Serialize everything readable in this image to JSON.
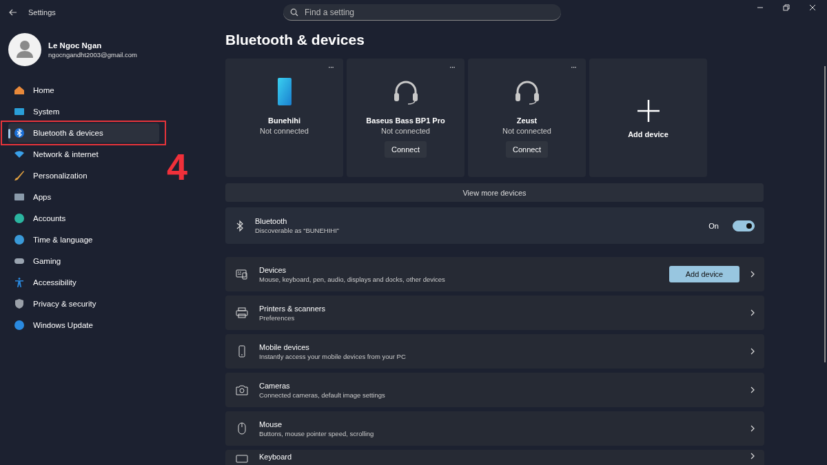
{
  "window": {
    "title": "Settings"
  },
  "search": {
    "placeholder": "Find a setting"
  },
  "user": {
    "name": "Le Ngoc Ngan",
    "email": "ngocngandht2003@gmail.com"
  },
  "nav": [
    {
      "label": "Home",
      "selected": false
    },
    {
      "label": "System",
      "selected": false
    },
    {
      "label": "Bluetooth & devices",
      "selected": true
    },
    {
      "label": "Network & internet",
      "selected": false
    },
    {
      "label": "Personalization",
      "selected": false
    },
    {
      "label": "Apps",
      "selected": false
    },
    {
      "label": "Accounts",
      "selected": false
    },
    {
      "label": "Time & language",
      "selected": false
    },
    {
      "label": "Gaming",
      "selected": false
    },
    {
      "label": "Accessibility",
      "selected": false
    },
    {
      "label": "Privacy & security",
      "selected": false
    },
    {
      "label": "Windows Update",
      "selected": false
    }
  ],
  "annotation": {
    "step": "4"
  },
  "page_title": "Bluetooth & devices",
  "devices": [
    {
      "kind": "phone",
      "name": "Bunehihi",
      "status": "Not connected",
      "more": "···"
    },
    {
      "kind": "headset",
      "name": "Baseus Bass BP1 Pro",
      "status": "Not connected",
      "more": "···",
      "action": "Connect"
    },
    {
      "kind": "headset",
      "name": "Zeust",
      "status": "Not connected",
      "more": "···",
      "action": "Connect"
    },
    {
      "kind": "add",
      "name": "Add device"
    }
  ],
  "view_more": "View more devices",
  "bluetooth": {
    "title": "Bluetooth",
    "subtitle": "Discoverable as “BUNEHIHI”",
    "state_label": "On",
    "on": true
  },
  "settings": [
    {
      "title": "Devices",
      "subtitle": "Mouse, keyboard, pen, audio, displays and docks, other devices",
      "button": "Add device"
    },
    {
      "title": "Printers & scanners",
      "subtitle": "Preferences"
    },
    {
      "title": "Mobile devices",
      "subtitle": "Instantly access your mobile devices from your PC"
    },
    {
      "title": "Cameras",
      "subtitle": "Connected cameras, default image settings"
    },
    {
      "title": "Mouse",
      "subtitle": "Buttons, mouse pointer speed, scrolling"
    },
    {
      "title": "Keyboard"
    }
  ]
}
